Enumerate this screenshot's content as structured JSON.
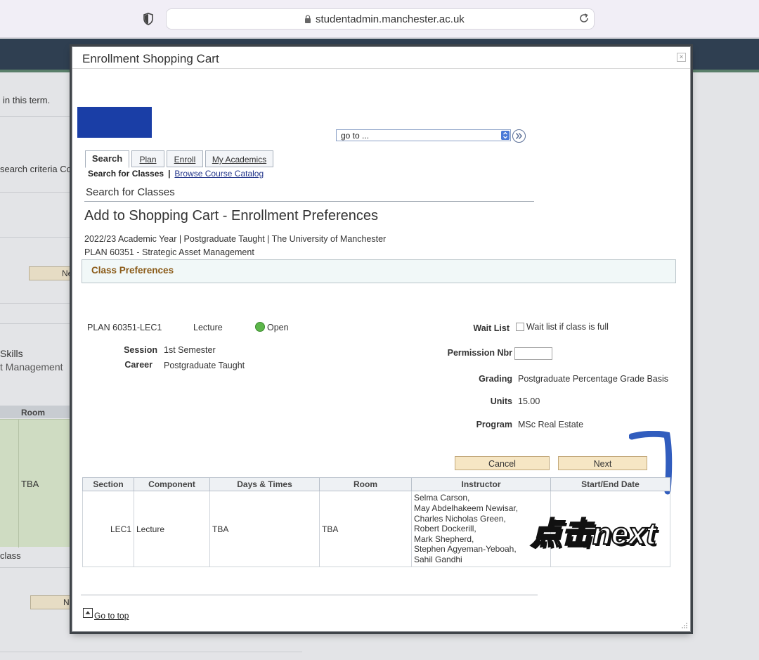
{
  "browser": {
    "url": "studentadmin.manchester.ac.uk"
  },
  "background": {
    "text_term": "in this term.",
    "text_search": "search criteria Cou",
    "btn_1": "Ne",
    "text_skills": "Skills",
    "text_mgmt": "t Management",
    "room_header": "Room",
    "room_value": "TBA",
    "text_class": "class",
    "btn_2": "Ne"
  },
  "modal": {
    "title": "Enrollment Shopping Cart",
    "close_glyph": "×",
    "goto_select": "go to ...",
    "tabs": [
      {
        "label": "Search",
        "active": true
      },
      {
        "label": "Plan"
      },
      {
        "label": "Enroll"
      },
      {
        "label": "My Academics"
      }
    ],
    "subnav": {
      "current": "Search for Classes",
      "separator": "|",
      "link": "Browse Course Catalog"
    },
    "search_heading": "Search for Classes",
    "page_title": "Add to Shopping Cart - Enrollment Preferences",
    "term_line": "2022/23 Academic Year | Postgraduate Taught | The University of Manchester",
    "plan_line": "PLAN 60351 - Strategic Asset Management",
    "class_pref_title": "Class Preferences",
    "class_id": "PLAN 60351-LEC1",
    "class_type": "Lecture",
    "status": "Open",
    "status_color": "#5cb64a",
    "session_label": "Session",
    "session_value": "1st Semester",
    "career_label": "Career",
    "career_value": "Postgraduate Taught",
    "waitlist_label": "Wait List",
    "waitlist_checkbox_label": "Wait list if class is full",
    "permission_label": "Permission Nbr",
    "grading_label": "Grading",
    "grading_value": "Postgraduate Percentage Grade Basis",
    "units_label": "Units",
    "units_value": "15.00",
    "program_label": "Program",
    "program_value": "MSc Real Estate",
    "cancel_label": "Cancel",
    "next_label": "Next",
    "table": {
      "headers": [
        "Section",
        "Component",
        "Days & Times",
        "Room",
        "Instructor",
        "Start/End Date"
      ],
      "row": {
        "section": "LEC1",
        "component": "Lecture",
        "days_times": "TBA",
        "room": "TBA",
        "instructors": [
          "Selma Carson,",
          "May Abdelhakeem Newisar,",
          "Charles Nicholas Green,",
          "Robert Dockerill,",
          "Mark Shepherd,",
          "Stephen Agyeman-Yeboah,",
          "Sahil Gandhi"
        ],
        "start_end": ""
      }
    },
    "overlay_annotation": "点击next",
    "go_to_top": "Go to top"
  },
  "colors": {
    "accent_blue_block": "#1a3ea6",
    "button_fill": "#f6e6c4",
    "pref_title": "#8a5a17"
  }
}
